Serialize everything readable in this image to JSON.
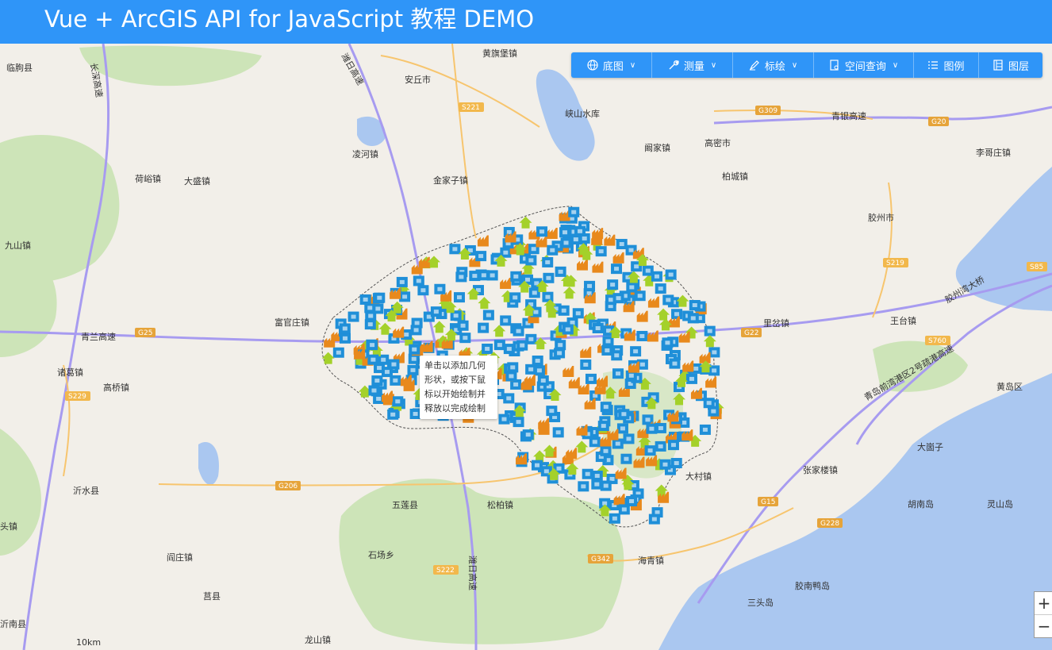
{
  "header": {
    "title": "Vue + ArcGIS API for JavaScript 教程 DEMO"
  },
  "toolbar": {
    "items": [
      {
        "label": "底图",
        "icon": "globe-icon",
        "has_dropdown": true
      },
      {
        "label": "测量",
        "icon": "wrench-icon",
        "has_dropdown": true
      },
      {
        "label": "标绘",
        "icon": "pen-icon",
        "has_dropdown": true
      },
      {
        "label": "空间查询",
        "icon": "query-icon",
        "has_dropdown": true
      },
      {
        "label": "图例",
        "icon": "list-icon",
        "has_dropdown": false
      },
      {
        "label": "图层",
        "icon": "layers-icon",
        "has_dropdown": false
      }
    ]
  },
  "tooltip": {
    "text": "单击以添加几何形状，或按下鼠标以开始绘制并释放以完成绘制"
  },
  "zoom": {
    "in": "+",
    "out": "−"
  },
  "scale": {
    "text": "10km"
  },
  "colors": {
    "header": "#2f95f8",
    "marker_blue": "#1f8fd8",
    "marker_orange": "#e8891c",
    "marker_green": "#a4d12a",
    "water": "#aac7f0",
    "green_area": "#cde4b8"
  },
  "map_labels": [
    "临朐县",
    "黄旗堡镇",
    "安丘市",
    "峡山水库",
    "高密市",
    "阚家镇",
    "凌河镇",
    "金家子镇",
    "大盛镇",
    "荷峪镇",
    "柏城镇",
    "胶州市",
    "李哥庄镇",
    "九山镇",
    "富官庄镇",
    "里岔镇",
    "王台镇",
    "诸葛镇",
    "高桥镇",
    "黄岛区",
    "大崮子",
    "沂水县",
    "五莲县",
    "松柏镇",
    "大村镇",
    "张家楼镇",
    "胡南岛",
    "灵山岛",
    "石场乡",
    "阎庄镇",
    "海青镇",
    "莒县",
    "胶南鸭岛",
    "三头岛",
    "龙山镇",
    "沂南县",
    "头镇",
    "潍日高速",
    "长深高速",
    "青兰高速",
    "青银高速",
    "胶州湾大桥",
    "青岛前湾港区2号疏港高速",
    "S221",
    "S229",
    "G25",
    "G206",
    "S222",
    "G342",
    "G309",
    "G20",
    "S85",
    "S219",
    "S760",
    "G22",
    "G228",
    "G15",
    "潍日高速"
  ]
}
